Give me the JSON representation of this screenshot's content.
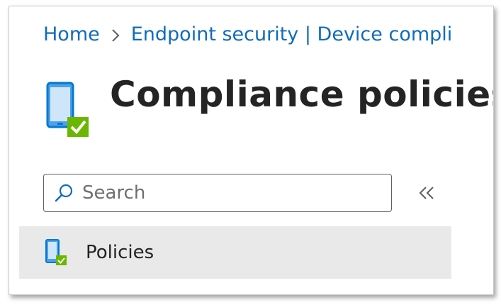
{
  "breadcrumb": {
    "home": "Home",
    "endpoint": "Endpoint security | Device compli"
  },
  "header": {
    "title": "Compliance policies",
    "icon": "compliance-device-icon"
  },
  "search": {
    "placeholder": "Search",
    "value": ""
  },
  "collapse": {
    "icon": "double-chevron-left-icon"
  },
  "nav": {
    "items": [
      {
        "label": "Policies",
        "icon": "compliance-device-icon",
        "selected": true
      }
    ]
  },
  "colors": {
    "link": "#0f6cbd",
    "text": "#242424",
    "selected_bg": "#e9e9e9",
    "check_green": "#6bb700",
    "device_blue": "#0078d4"
  }
}
